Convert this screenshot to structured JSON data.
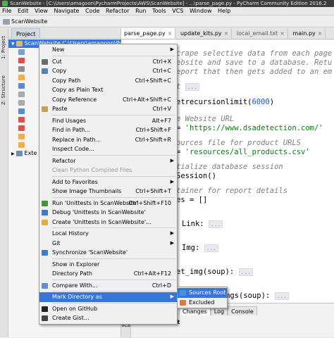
{
  "window": {
    "title": "ScanWebsite - [C:\\Users\\amagoon\\PycharmProjects\\AWS\\ScanWebsite] - ...\\parse_page.py - PyCharm Community Edition 2016.2"
  },
  "menubar": [
    "File",
    "Edit",
    "View",
    "Navigate",
    "Code",
    "Refactor",
    "Run",
    "Tools",
    "VCS",
    "Window",
    "Help"
  ],
  "navbar": {
    "project_name": "ScanWebsite"
  },
  "side_labels": {
    "project": "1: Project",
    "structure": "Z: Structure"
  },
  "project_panel": {
    "tab_label": "Project",
    "tree": [
      {
        "label": "ScanWebsite  C:\\Users\\amagoon\\PycharmProjects\\AWS\\ScanWebsite"
      },
      {
        "label": "Exte"
      }
    ]
  },
  "editor_tabs": [
    "parse_page.py",
    "update_kits.py",
    "local_email.txt",
    "main.py"
  ],
  "code": {
    "line1": "crape selective data from each page",
    "line2": "ebsite and save to a database. Retu",
    "line3": "eport that then gets added to an em",
    "line4": "t",
    "line5": "etrecursionlimit(",
    "line5_num": "6000",
    "line5_end": ")",
    "line6": "e Website URL",
    "line7a": "= ",
    "line7b": "'https://www.dsadetection.com/'",
    "line8": "ources file for product URLS",
    "line9a": "= ",
    "line9b": "'resources/all_products.csv'",
    "line10": "tialize database session",
    "line11": "Session()",
    "line12": "tainer for report details",
    "line13": "es = []",
    "line14": "Link:",
    "line15": "Img:",
    "line16": "et_img(soup):",
    "line17": "mgs(soup):",
    "fold": "..."
  },
  "context_menu": [
    {
      "type": "item",
      "label": "New",
      "shortcut": "",
      "submenu": true,
      "icon": ""
    },
    {
      "type": "sep"
    },
    {
      "type": "item",
      "label": "Cut",
      "shortcut": "Ctrl+X",
      "icon": "scissors-icon"
    },
    {
      "type": "item",
      "label": "Copy",
      "shortcut": "Ctrl+C",
      "icon": "copy-icon"
    },
    {
      "type": "item",
      "label": "Copy Path",
      "shortcut": "Ctrl+Shift+C",
      "icon": ""
    },
    {
      "type": "item",
      "label": "Copy as Plain Text",
      "shortcut": "",
      "icon": ""
    },
    {
      "type": "item",
      "label": "Copy Reference",
      "shortcut": "Ctrl+Alt+Shift+C",
      "icon": ""
    },
    {
      "type": "item",
      "label": "Paste",
      "shortcut": "Ctrl+V",
      "icon": "paste-icon"
    },
    {
      "type": "sep"
    },
    {
      "type": "item",
      "label": "Find Usages",
      "shortcut": "Alt+F7",
      "icon": ""
    },
    {
      "type": "item",
      "label": "Find in Path...",
      "shortcut": "Ctrl+Shift+F",
      "icon": ""
    },
    {
      "type": "item",
      "label": "Replace in Path...",
      "shortcut": "Ctrl+Shift+R",
      "icon": ""
    },
    {
      "type": "item",
      "label": "Inspect Code...",
      "shortcut": "",
      "icon": ""
    },
    {
      "type": "sep"
    },
    {
      "type": "item",
      "label": "Refactor",
      "shortcut": "",
      "submenu": true,
      "icon": ""
    },
    {
      "type": "item",
      "label": "Clean Python Compiled Files",
      "shortcut": "",
      "disabled": true,
      "icon": ""
    },
    {
      "type": "sep"
    },
    {
      "type": "item",
      "label": "Add to Favorites",
      "shortcut": "",
      "submenu": true,
      "icon": ""
    },
    {
      "type": "item",
      "label": "Show Image Thumbnails",
      "shortcut": "Ctrl+Shift+T",
      "icon": ""
    },
    {
      "type": "sep"
    },
    {
      "type": "item",
      "label": "Run 'Unittests in ScanWebsite'",
      "shortcut": "Ctrl+Shift+F10",
      "icon": "run-icon"
    },
    {
      "type": "item",
      "label": "Debug 'Unittests in ScanWebsite'",
      "shortcut": "",
      "icon": "debug-icon"
    },
    {
      "type": "item",
      "label": "Create 'Unittests in ScanWebsite'...",
      "shortcut": "",
      "icon": "python-icon"
    },
    {
      "type": "sep"
    },
    {
      "type": "item",
      "label": "Local History",
      "shortcut": "",
      "submenu": true,
      "icon": ""
    },
    {
      "type": "item",
      "label": "Git",
      "shortcut": "",
      "submenu": true,
      "icon": ""
    },
    {
      "type": "item",
      "label": "Synchronize 'ScanWebsite'",
      "shortcut": "",
      "icon": "sync-icon"
    },
    {
      "type": "sep"
    },
    {
      "type": "item",
      "label": "Show in Explorer",
      "shortcut": "",
      "icon": ""
    },
    {
      "type": "item",
      "label": "Directory Path",
      "shortcut": "Ctrl+Alt+F12",
      "icon": ""
    },
    {
      "type": "sep"
    },
    {
      "type": "item",
      "label": "Compare With...",
      "shortcut": "Ctrl+D",
      "icon": "compare-icon"
    },
    {
      "type": "sep"
    },
    {
      "type": "item",
      "label": "Mark Directory as",
      "shortcut": "",
      "submenu": true,
      "highlight": true,
      "icon": ""
    },
    {
      "type": "sep"
    },
    {
      "type": "item",
      "label": "Open on GitHub",
      "shortcut": "",
      "icon": "github-icon"
    },
    {
      "type": "item",
      "label": "Create Gist...",
      "shortcut": "",
      "icon": "gist-icon"
    }
  ],
  "submenu": [
    {
      "label": "Sources Root",
      "highlight": true,
      "icon": "sources-root-icon"
    },
    {
      "label": "Excluded",
      "highlight": false,
      "icon": "excluded-icon"
    }
  ],
  "bottom_panel": {
    "tabs": [
      "Changes",
      "Log",
      "Console"
    ],
    "default_label": "Default",
    "vcs_label": "VCS"
  },
  "colors": {
    "selection": "#3875d7",
    "string": "#067d17",
    "comment": "#808080",
    "number": "#1750eb"
  }
}
